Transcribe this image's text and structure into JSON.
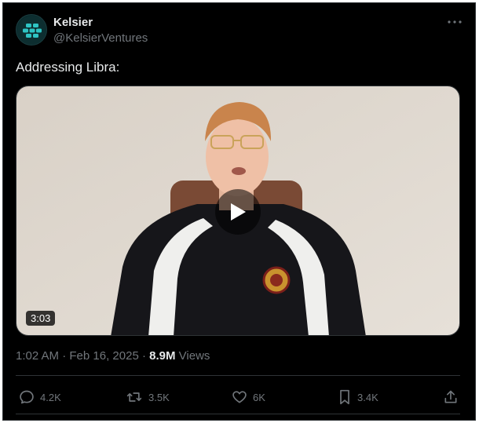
{
  "author": {
    "display_name": "Kelsier",
    "handle": "@KelsierVentures",
    "avatar_icon": "kelsier-logo"
  },
  "tweet": {
    "text": "Addressing Libra:",
    "video": {
      "duration": "3:03",
      "play_icon": "play-icon"
    },
    "time": "1:02 AM",
    "date": "Feb 16, 2025",
    "separator_1": "·",
    "separator_2": "·",
    "views_count": "8.9M",
    "views_label": "Views"
  },
  "actions": {
    "replies": "4.2K",
    "reposts": "3.5K",
    "likes": "6K",
    "bookmarks": "3.4K"
  },
  "colors": {
    "background": "#000000",
    "primary_text": "#e7e9ea",
    "secondary_text": "#71767b",
    "border": "#2f3336",
    "avatar_accent": "#2ec4c4"
  }
}
